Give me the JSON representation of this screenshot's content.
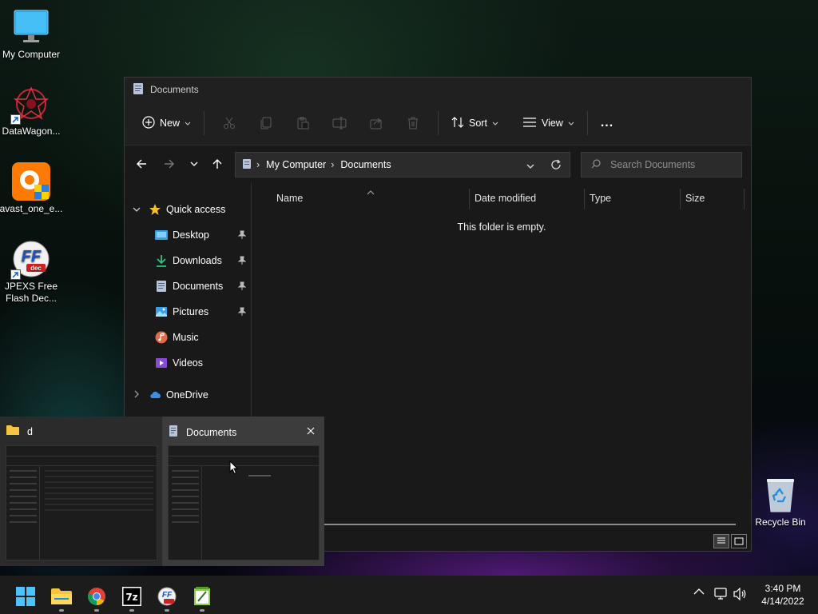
{
  "desktop": {
    "icons": [
      {
        "label": "My Computer",
        "icon": "monitor-icon"
      },
      {
        "label": "DataWagon...",
        "icon": "datawagon-icon"
      },
      {
        "label": "avast_one_e...",
        "icon": "avast-icon"
      },
      {
        "label": "JPEXS Free Flash Dec...",
        "icon": "ffdec-icon"
      }
    ],
    "recycle_bin": {
      "label": "Recycle Bin",
      "icon": "recycle-bin-icon"
    }
  },
  "window": {
    "title": "Documents",
    "toolbar": {
      "new_label": "New",
      "sort_label": "Sort",
      "view_label": "View",
      "more_label": "...",
      "disabled_icons": [
        "cut-icon",
        "copy-icon",
        "paste-icon",
        "rename-icon",
        "share-icon",
        "delete-icon"
      ]
    },
    "address": {
      "segments": [
        "My Computer",
        "Documents"
      ]
    },
    "search": {
      "placeholder": "Search Documents"
    },
    "sidebar": {
      "quick_access_label": "Quick access",
      "items": [
        {
          "label": "Desktop",
          "pinned": true,
          "icon": "desktop-folder-icon"
        },
        {
          "label": "Downloads",
          "pinned": true,
          "icon": "downloads-icon"
        },
        {
          "label": "Documents",
          "pinned": true,
          "icon": "documents-icon"
        },
        {
          "label": "Pictures",
          "pinned": true,
          "icon": "pictures-icon"
        },
        {
          "label": "Music",
          "pinned": false,
          "icon": "music-icon"
        },
        {
          "label": "Videos",
          "pinned": false,
          "icon": "videos-icon"
        }
      ],
      "onedrive_label": "OneDrive"
    },
    "columns": [
      "Name",
      "Date modified",
      "Type",
      "Size"
    ],
    "empty_message": "This folder is empty."
  },
  "flyout": {
    "thumbs": [
      {
        "title": "d",
        "icon": "folder-icon",
        "active": false
      },
      {
        "title": "Documents",
        "icon": "documents-icon",
        "active": true
      }
    ]
  },
  "taskbar": {
    "apps": [
      "start-icon",
      "file-explorer-icon",
      "chrome-icon",
      "7zip-icon",
      "ffdec-icon",
      "notepad-icon"
    ],
    "time": "3:40 PM",
    "date": "4/14/2022"
  },
  "colors": {
    "accent": "#4cc2ff",
    "window_bg": "#191919",
    "taskbar_bg": "#1c1c1c"
  }
}
